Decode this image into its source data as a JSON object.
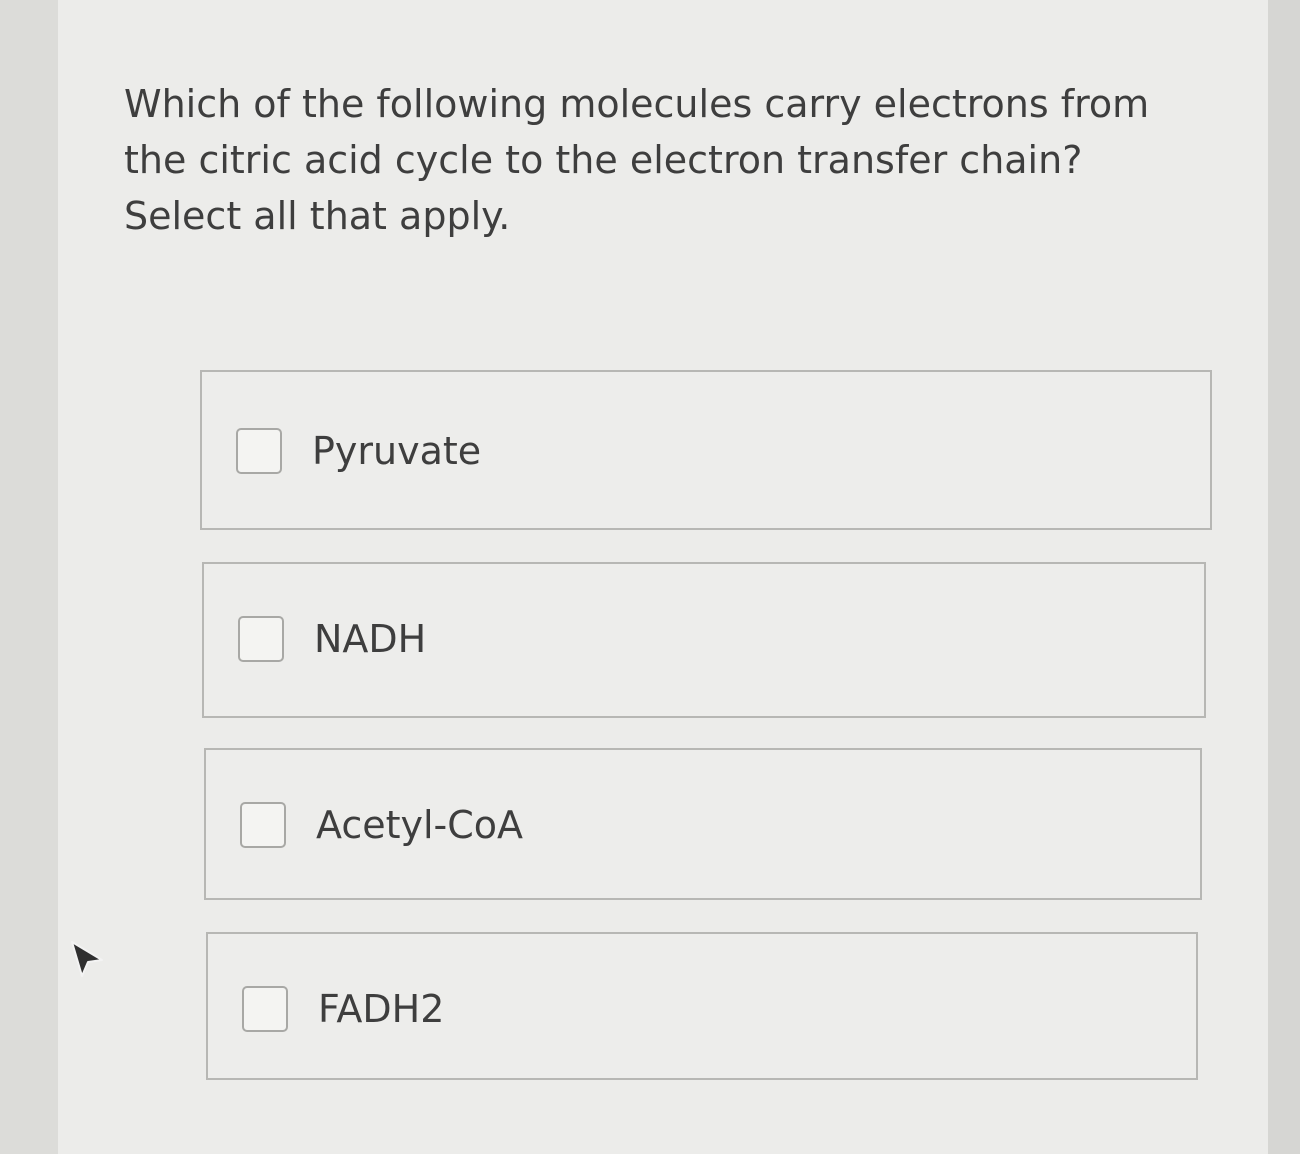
{
  "question": {
    "text": "Which of the following molecules carry electrons from the citric acid cycle to the electron transfer chain? Select all that apply."
  },
  "options": [
    {
      "label": "Pyruvate",
      "checked": false
    },
    {
      "label": "NADH",
      "checked": false
    },
    {
      "label": "Acetyl-CoA",
      "checked": false
    },
    {
      "label": "FADH2",
      "checked": false
    }
  ],
  "colors": {
    "text": "#3e3e3e",
    "border": "#b7b7b4",
    "background": "#ececea"
  },
  "icons": {
    "checkbox": "checkbox-unchecked-icon",
    "cursor": "mouse-pointer-icon"
  }
}
